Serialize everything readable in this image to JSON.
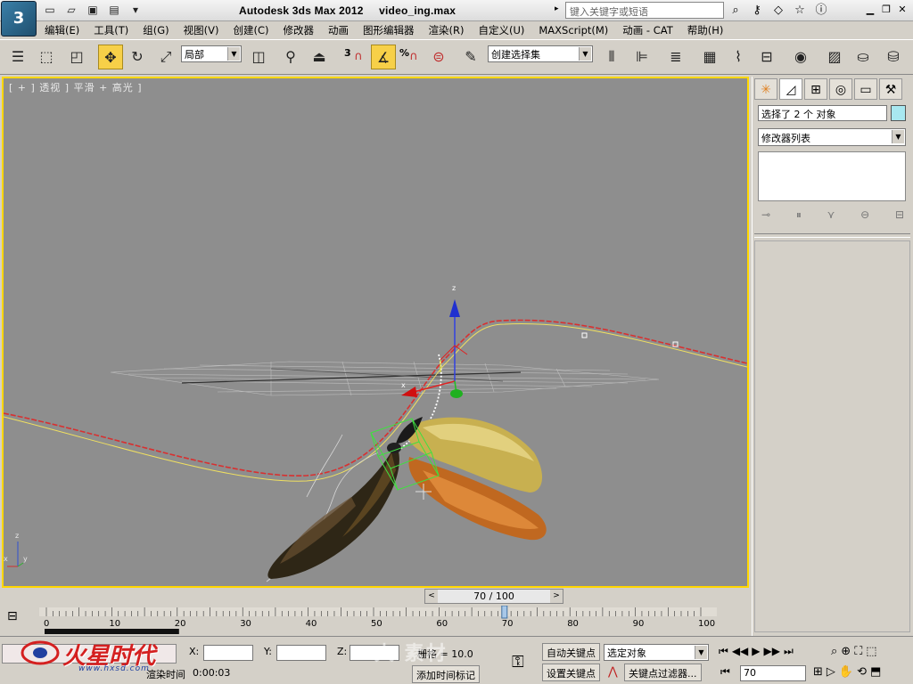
{
  "window": {
    "app_title": "Autodesk 3ds Max  2012",
    "file_name": "video_ing.max",
    "search_placeholder": "键入关键字或短语",
    "app_logo_glyph": "3"
  },
  "menu": [
    "编辑(E)",
    "工具(T)",
    "组(G)",
    "视图(V)",
    "创建(C)",
    "修改器",
    "动画",
    "图形编辑器",
    "渲染(R)",
    "自定义(U)",
    "MAXScript(M)",
    "动画 - CAT",
    "帮助(H)"
  ],
  "toolbar": {
    "reference_coord": "局部",
    "selection_set": "创建选择集",
    "snap_3": "3",
    "snap_percent": "%"
  },
  "viewport": {
    "label": "[ + ] 透视 ] 平滑 + 高光 ]",
    "axis_z": "z",
    "axis_x": "x",
    "axis_y": "y"
  },
  "command_panel": {
    "selection_info": "选择了 2 个 对象",
    "modifier_list": "修改器列表",
    "object_color": "#a8e8f0"
  },
  "time_slider": {
    "label": "70 / 100",
    "prev": "<",
    "next": ">"
  },
  "trackbar": {
    "ticks": [
      "0",
      "10",
      "20",
      "30",
      "40",
      "50",
      "60",
      "70",
      "80",
      "90",
      "100"
    ],
    "current_frame": 70
  },
  "status": {
    "x_label": "X:",
    "y_label": "Y:",
    "z_label": "Z:",
    "grid": "栅格 = 10.0",
    "add_time_tag": "添加时间标记",
    "render_time_label": "渲染时间",
    "render_time": "0:00:03",
    "auto_key": "自动关键点",
    "set_key": "设置关键点",
    "key_filter_select": "选定对象",
    "key_filters": "关键点过滤器...",
    "frame_value": "70"
  },
  "watermark": {
    "text": "火星时代",
    "url": "www.hxsd.com",
    "text2": "大 素材"
  }
}
